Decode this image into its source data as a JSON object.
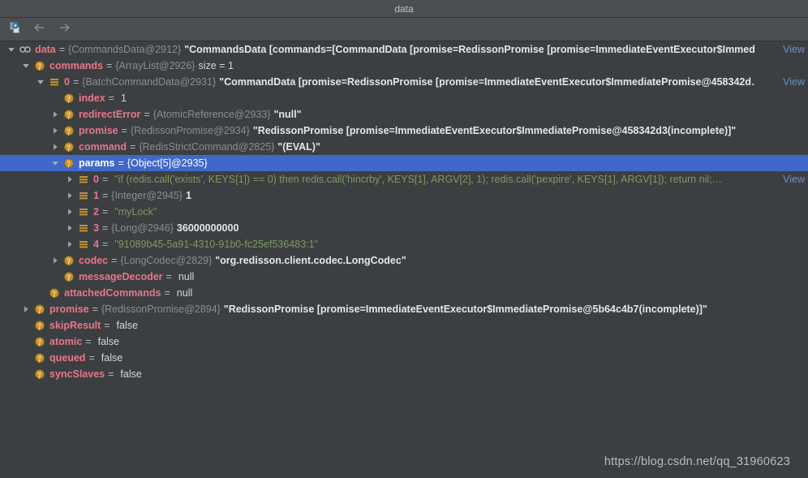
{
  "window": {
    "title": "data"
  },
  "toolbar": {
    "buttons": [
      {
        "name": "evaluate-expression-icon",
        "label": ""
      },
      {
        "name": "back-arrow-icon",
        "label": ""
      },
      {
        "name": "forward-arrow-icon",
        "label": ""
      }
    ]
  },
  "watermark": "https://blog.csdn.net/qq_31960623",
  "colors": {
    "background": "#3c3f41",
    "selection": "#4068c9",
    "field_name": "#e8768a",
    "type_name": "#8c8c8c",
    "string_value": "#e6e6e6",
    "link": "#6a8fc4"
  },
  "view_label": "View",
  "tree": {
    "rows": [
      {
        "indent": 0,
        "toggle": "expanded",
        "icon": "parameter-icon",
        "name": "data",
        "eq": "=",
        "type": "{CommandsData@2912}",
        "value": "\"CommandsData [commands=[CommandData [promise=RedissonPromise [promise=ImmediateEventExecutor$Immed…",
        "value_style": "string",
        "view": true,
        "selected": false
      },
      {
        "indent": 1,
        "toggle": "expanded",
        "icon": "field-icon",
        "name": "commands",
        "eq": "=",
        "type": "{ArrayList@2926}",
        "value": "size = 1",
        "value_style": "plain",
        "view": false,
        "selected": false
      },
      {
        "indent": 2,
        "toggle": "expanded",
        "icon": "array-element-icon",
        "name": "0",
        "eq": "=",
        "type": "{BatchCommandData@2931}",
        "value": "\"CommandData [promise=RedissonPromise [promise=ImmediateEventExecutor$ImmediatePromise@458342d…",
        "value_style": "string",
        "view": true,
        "selected": false
      },
      {
        "indent": 3,
        "toggle": "none",
        "icon": "field-icon",
        "name": "index",
        "eq": "=",
        "type": "",
        "value": "1",
        "value_style": "plain",
        "view": false,
        "selected": false
      },
      {
        "indent": 3,
        "toggle": "collapsed",
        "icon": "field-icon",
        "name": "redirectError",
        "eq": "=",
        "type": "{AtomicReference@2933}",
        "value": "\"null\"",
        "value_style": "string",
        "view": false,
        "selected": false
      },
      {
        "indent": 3,
        "toggle": "collapsed",
        "icon": "field-icon",
        "name": "promise",
        "eq": "=",
        "type": "{RedissonPromise@2934}",
        "value": "\"RedissonPromise [promise=ImmediateEventExecutor$ImmediatePromise@458342d3(incomplete)]\"",
        "value_style": "string",
        "view": false,
        "selected": false
      },
      {
        "indent": 3,
        "toggle": "collapsed",
        "icon": "field-icon",
        "name": "command",
        "eq": "=",
        "type": "{RedisStrictCommand@2825}",
        "value": "\"(EVAL)\"",
        "value_style": "string",
        "view": false,
        "selected": false
      },
      {
        "indent": 3,
        "toggle": "expanded",
        "icon": "field-icon",
        "name": "params",
        "eq": "=",
        "type": "{Object[5]@2935}",
        "value": "",
        "value_style": "plain",
        "view": false,
        "selected": true
      },
      {
        "indent": 4,
        "toggle": "collapsed",
        "icon": "array-element-icon",
        "name": "0",
        "eq": "=",
        "type": "",
        "value": "\"if (redis.call('exists', KEYS[1]) == 0) then redis.call('hincrby', KEYS[1], ARGV[2], 1); redis.call('pexpire', KEYS[1], ARGV[1]); return nil;…",
        "value_style": "green-string",
        "view": true,
        "selected": false
      },
      {
        "indent": 4,
        "toggle": "collapsed",
        "icon": "array-element-icon",
        "name": "1",
        "eq": "=",
        "type": "{Integer@2945}",
        "value": "1",
        "value_style": "bold",
        "view": false,
        "selected": false
      },
      {
        "indent": 4,
        "toggle": "collapsed",
        "icon": "array-element-icon",
        "name": "2",
        "eq": "=",
        "type": "",
        "value": "\"myLock\"",
        "value_style": "green-string",
        "view": false,
        "selected": false
      },
      {
        "indent": 4,
        "toggle": "collapsed",
        "icon": "array-element-icon",
        "name": "3",
        "eq": "=",
        "type": "{Long@2946}",
        "value": "36000000000",
        "value_style": "bold",
        "view": false,
        "selected": false
      },
      {
        "indent": 4,
        "toggle": "collapsed",
        "icon": "array-element-icon",
        "name": "4",
        "eq": "=",
        "type": "",
        "value": "\"91089b45-5a91-4310-91b0-fc25ef536483:1\"",
        "value_style": "green-string",
        "view": false,
        "selected": false
      },
      {
        "indent": 3,
        "toggle": "collapsed",
        "icon": "field-icon",
        "name": "codec",
        "eq": "=",
        "type": "{LongCodec@2829}",
        "value": "\"org.redisson.client.codec.LongCodec\"",
        "value_style": "string",
        "view": false,
        "selected": false
      },
      {
        "indent": 3,
        "toggle": "none",
        "icon": "field-icon",
        "name": "messageDecoder",
        "eq": "=",
        "type": "",
        "value": "null",
        "value_style": "plain",
        "view": false,
        "selected": false
      },
      {
        "indent": 2,
        "toggle": "none",
        "icon": "field-icon",
        "name": "attachedCommands",
        "eq": "=",
        "type": "",
        "value": "null",
        "value_style": "plain",
        "view": false,
        "selected": false
      },
      {
        "indent": 1,
        "toggle": "collapsed",
        "icon": "field-icon",
        "name": "promise",
        "eq": "=",
        "type": "{RedissonPromise@2894}",
        "value": "\"RedissonPromise [promise=ImmediateEventExecutor$ImmediatePromise@5b64c4b7(incomplete)]\"",
        "value_style": "string",
        "view": false,
        "selected": false
      },
      {
        "indent": 1,
        "toggle": "none",
        "icon": "field-icon",
        "name": "skipResult",
        "eq": "=",
        "type": "",
        "value": "false",
        "value_style": "plain",
        "view": false,
        "selected": false
      },
      {
        "indent": 1,
        "toggle": "none",
        "icon": "field-icon",
        "name": "atomic",
        "eq": "=",
        "type": "",
        "value": "false",
        "value_style": "plain",
        "view": false,
        "selected": false
      },
      {
        "indent": 1,
        "toggle": "none",
        "icon": "field-icon",
        "name": "queued",
        "eq": "=",
        "type": "",
        "value": "false",
        "value_style": "plain",
        "view": false,
        "selected": false
      },
      {
        "indent": 1,
        "toggle": "none",
        "icon": "field-icon",
        "name": "syncSlaves",
        "eq": "=",
        "type": "",
        "value": "false",
        "value_style": "plain",
        "view": false,
        "selected": false
      }
    ]
  }
}
